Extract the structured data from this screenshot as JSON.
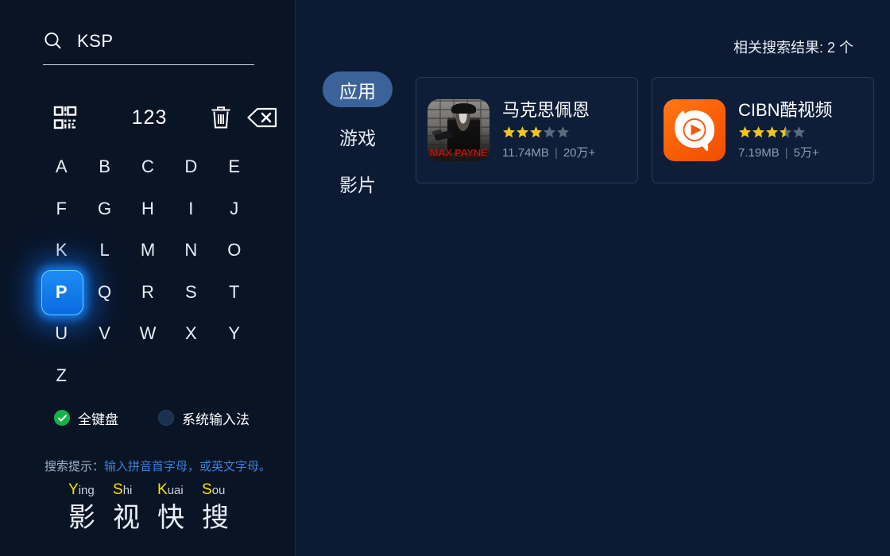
{
  "search": {
    "icon": "search-icon",
    "value": "KSP",
    "placeholder": "KSP"
  },
  "toolbar": {
    "qr_icon": "qr-code-icon",
    "numeric_label": "123",
    "clear_icon": "trash-icon",
    "backspace_icon": "backspace-icon"
  },
  "keyboard": {
    "rows": [
      [
        "A",
        "B",
        "C",
        "D",
        "E"
      ],
      [
        "F",
        "G",
        "H",
        "I",
        "J"
      ],
      [
        "K",
        "L",
        "M",
        "N",
        "O"
      ],
      [
        "P",
        "Q",
        "R",
        "S",
        "T"
      ],
      [
        "U",
        "V",
        "W",
        "X",
        "Y"
      ],
      [
        "Z"
      ]
    ],
    "focused_key": "P",
    "focus_color": "#1e8cf5",
    "focus_glow": "#63d7ff"
  },
  "input_modes": [
    {
      "label": "全键盘",
      "selected": true,
      "color": "#13b34a"
    },
    {
      "label": "系统输入法",
      "selected": false,
      "color": "#1b3050"
    }
  ],
  "hint": {
    "label": "搜索提示：",
    "text": "输入拼音首字母，或英文字母。",
    "text_color": "#3f7fd4",
    "examples": [
      {
        "initial": "Y",
        "rest": "ing",
        "han": "影"
      },
      {
        "initial": "S",
        "rest": "hi",
        "han": "视"
      },
      {
        "initial": "K",
        "rest": "uai",
        "han": "快"
      },
      {
        "initial": "S",
        "rest": "ou",
        "han": "搜"
      }
    ],
    "initial_color": "#ffe200"
  },
  "results": {
    "count_label": "相关搜索结果: 2 个",
    "categories": [
      {
        "label": "应用",
        "active": true
      },
      {
        "label": "游戏",
        "active": false
      },
      {
        "label": "影片",
        "active": false
      }
    ],
    "active_tab_color": "#3b6399",
    "cards": [
      {
        "title": "马克思佩恩",
        "icon": "max-payne-app-icon",
        "icon_text": "MAX PAYNE",
        "rating": 3,
        "size": "11.74MB",
        "separator": "|",
        "downloads": "20万+"
      },
      {
        "title": "CIBN酷视频",
        "icon": "cibn-app-icon",
        "icon_text": "",
        "rating": 3.5,
        "size": "7.19MB",
        "separator": "|",
        "downloads": "5万+"
      }
    ],
    "star_filled_color": "#f5c518",
    "star_empty_color": "#5b6a7d"
  }
}
